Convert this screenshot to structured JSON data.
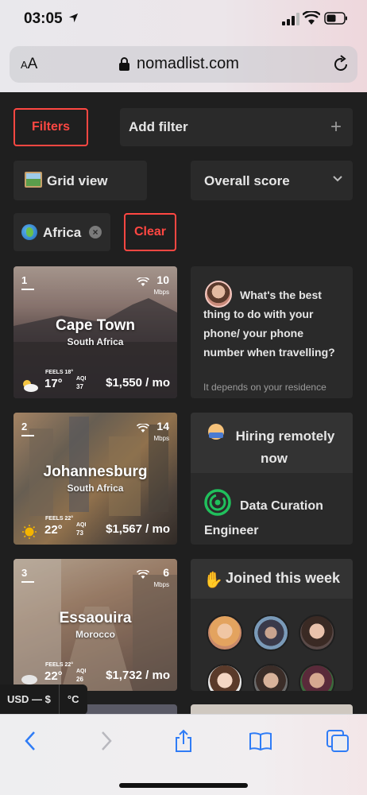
{
  "status_bar": {
    "time": "03:05"
  },
  "browser": {
    "text_size_label": "AA",
    "url": "nomadlist.com"
  },
  "filters": {
    "filters_label": "Filters",
    "add_filter_label": "Add filter",
    "add_symbol": "+",
    "view_label": "Grid view",
    "sort_label": "Overall score",
    "active_chip": "Africa",
    "clear_label": "Clear"
  },
  "cities": [
    {
      "rank": "1",
      "name": "Cape Town",
      "country": "South Africa",
      "internet": "10",
      "internet_unit": "Mbps",
      "feels": "FEELS 18°",
      "temp": "17°",
      "aqi_label": "AQI",
      "aqi": "37",
      "cost": "$1,550 / mo",
      "weather_icon": "partly-cloudy-icon"
    },
    {
      "rank": "2",
      "name": "Johannesburg",
      "country": "South Africa",
      "internet": "14",
      "internet_unit": "Mbps",
      "feels": "FEELS 22°",
      "temp": "22°",
      "aqi_label": "AQI",
      "aqi": "73",
      "cost": "$1,567 / mo",
      "weather_icon": "sunny-icon"
    },
    {
      "rank": "3",
      "name": "Essaouira",
      "country": "Morocco",
      "internet": "6",
      "internet_unit": "Mbps",
      "feels": "FEELS 22°",
      "temp": "22°",
      "aqi_label": "AQI",
      "aqi": "26",
      "cost": "$1,732 / mo",
      "weather_icon": "cloudy-icon"
    }
  ],
  "promo": {
    "question": "What's the best thing to do with your phone/ your phone number when travelling?",
    "answer": "It depends on your residence"
  },
  "hiring": {
    "title": "Hiring remotely now",
    "job_title": "Data Curation Engineer"
  },
  "joined": {
    "title": "Joined this week"
  },
  "settings": {
    "currency": "USD — $",
    "temperature_unit": "°C"
  },
  "colors": {
    "accent": "#ff4742",
    "background": "#1f1f1f",
    "card": "#2a2a2a"
  }
}
